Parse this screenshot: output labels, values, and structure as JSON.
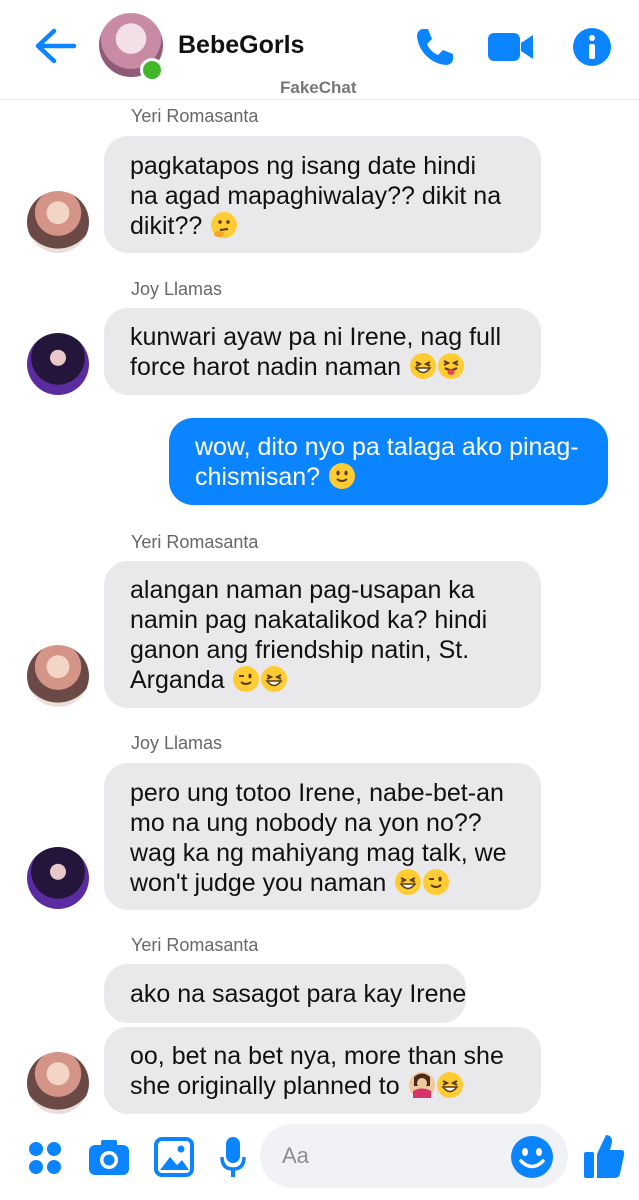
{
  "header": {
    "title": "BebeGorls",
    "watermark": "FakeChat",
    "online": true
  },
  "colors": {
    "accent": "#0a84ff",
    "incoming_bubble": "#e9e9ec",
    "online": "#42b72a"
  },
  "messages": [
    {
      "sender": "Yeri Romasanta",
      "lines": [
        "pagkatapos ng isang date hindi",
        "na agad mapaghiwalay?? dikit na",
        "dikit??"
      ],
      "emojis": [
        "thinking-face"
      ]
    },
    {
      "sender": "Joy Llamas",
      "lines": [
        "kunwari ayaw pa ni Irene, nag full",
        "force harot nadin naman"
      ],
      "emojis": [
        "grinning-squinting-face",
        "squinting-tongue-face"
      ]
    },
    {
      "sender": "",
      "outgoing": true,
      "lines": [
        "wow, dito nyo pa talaga ako pinag-",
        "chismisan?"
      ],
      "emojis": [
        "slightly-smiling-face"
      ]
    },
    {
      "sender": "Yeri Romasanta",
      "lines": [
        "alangan naman pag-usapan ka",
        "namin pag nakatalikod ka? hindi",
        "ganon ang friendship natin, St.",
        "Arganda"
      ],
      "emojis": [
        "winking-face",
        "grinning-squinting-face"
      ]
    },
    {
      "sender": "Joy Llamas",
      "lines": [
        "pero ung totoo Irene, nabe-bet-an",
        "mo na ung nobody na yon no??",
        "wag ka ng mahiyang mag talk, we",
        "won't judge you naman"
      ],
      "emojis": [
        "grinning-squinting-face",
        "winking-face"
      ]
    },
    {
      "sender": "Yeri Romasanta",
      "lines": [
        "ako na sasagot para kay Irene"
      ],
      "emojis": []
    },
    {
      "sender": "",
      "lines": [
        "oo, bet na bet nya, more than she",
        "she originally planned to"
      ],
      "emojis": [
        "person-shrugging",
        "grinning-squinting-face"
      ]
    }
  ],
  "composer": {
    "placeholder": "Aa",
    "icons": [
      "apps-icon",
      "camera-icon",
      "gallery-icon",
      "microphone-icon",
      "emoji-icon",
      "thumbs-up-icon"
    ]
  }
}
